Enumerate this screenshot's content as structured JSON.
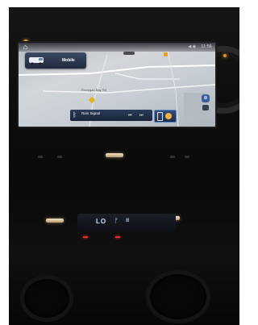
{
  "screen": {
    "time": "11:56",
    "signal_glyph": "◀ ◉",
    "destination": "Mobile",
    "map_labels": [
      "Finnegan Bay Rd"
    ],
    "media_title": "Rain Signal",
    "controls": {
      "prev": "⏮",
      "next": "⏭",
      "zoom": "⊕"
    }
  },
  "climate": {
    "temperature": "LO",
    "fan_glyph": "ᚠ",
    "defrost_glyph": "Ⅲ"
  },
  "colors": {
    "screen_accent": "#3b5f9a",
    "ambient": "#d98a2a",
    "temp": "#cfe3ff"
  }
}
